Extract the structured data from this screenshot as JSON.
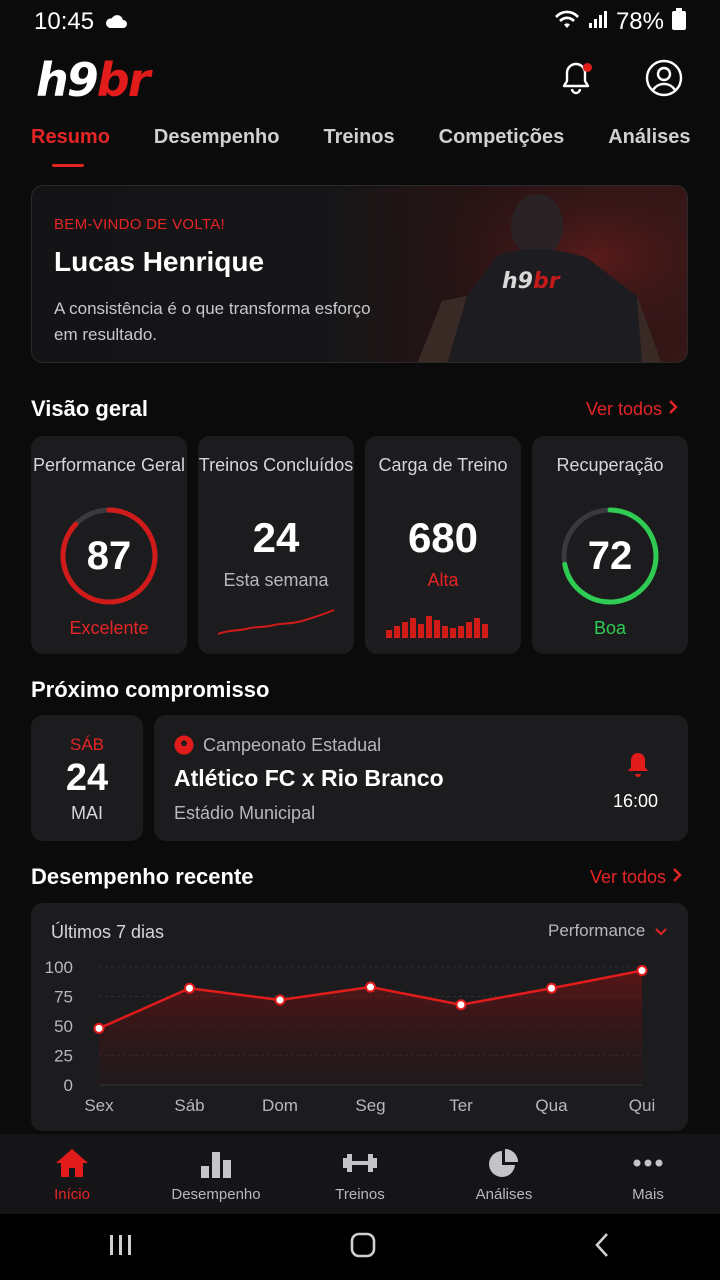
{
  "status": {
    "time": "10:45",
    "battery": "78%"
  },
  "logo": {
    "part1": "h9",
    "part2": "br"
  },
  "tabs": [
    {
      "label": "Resumo",
      "active": true
    },
    {
      "label": "Desempenho",
      "active": false
    },
    {
      "label": "Treinos",
      "active": false
    },
    {
      "label": "Competições",
      "active": false
    },
    {
      "label": "Análises",
      "active": false
    }
  ],
  "hero": {
    "kicker": "BEM-VINDO DE VOLTA!",
    "name": "Lucas Henrique",
    "quote": "A consistência é o que transforma esforço em resultado."
  },
  "overview": {
    "title": "Visão geral",
    "see_all": "Ver todos",
    "cards": [
      {
        "label": "Performance Geral",
        "value": "87",
        "sub": "Excelente",
        "ring_fraction": 0.87,
        "color": "#e21b1b"
      },
      {
        "label": "Treinos Concluídos",
        "value": "24",
        "sub": "Esta semana"
      },
      {
        "label": "Carga de Treino",
        "value": "680",
        "sub": "Alta"
      },
      {
        "label": "Recuperação",
        "value": "72",
        "sub": "Boa",
        "ring_fraction": 0.72,
        "color": "#2ecc52"
      }
    ]
  },
  "next_event": {
    "title": "Próximo compromisso",
    "day": "SÁB",
    "date": "24",
    "month": "MAI",
    "competition": "Campeonato Estadual",
    "match": "Atlético FC x Rio Branco",
    "venue": "Estádio Municipal",
    "time": "16:00"
  },
  "recent": {
    "title": "Desempenho recente",
    "see_all": "Ver todos",
    "period": "Últimos 7 dias",
    "metric": "Performance"
  },
  "chart_data": {
    "type": "area",
    "categories": [
      "Sex",
      "Sáb",
      "Dom",
      "Seg",
      "Ter",
      "Qua",
      "Qui"
    ],
    "values": [
      48,
      82,
      72,
      83,
      68,
      82,
      97
    ],
    "yticks": [
      100,
      75,
      50,
      25,
      0
    ],
    "ylim": [
      0,
      100
    ],
    "color": "#e21b1b"
  },
  "bottom_nav": [
    {
      "label": "Início",
      "active": true
    },
    {
      "label": "Desempenho",
      "active": false
    },
    {
      "label": "Treinos",
      "active": false
    },
    {
      "label": "Análises",
      "active": false
    },
    {
      "label": "Mais",
      "active": false
    }
  ]
}
